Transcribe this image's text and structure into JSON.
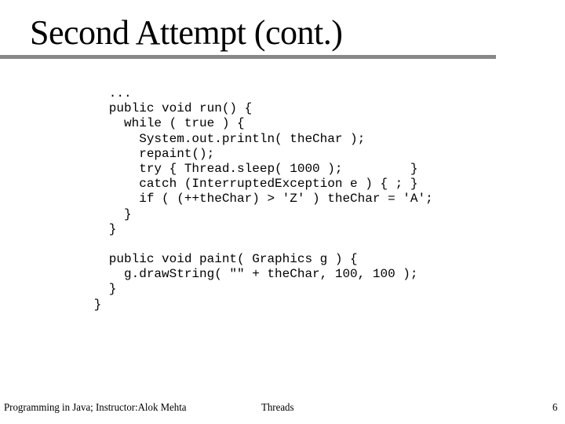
{
  "slide": {
    "title": "Second Attempt (cont.)",
    "code_lines": [
      "   ...",
      "   public void run() {",
      "     while ( true ) {",
      "       System.out.println( theChar );",
      "       repaint();",
      "       try { Thread.sleep( 1000 );         }",
      "       catch (InterruptedException e ) { ; }",
      "       if ( (++theChar) > 'Z' ) theChar = 'A';",
      "     }",
      "   }",
      "",
      "   public void paint( Graphics g ) {",
      "     g.drawString( \"\" + theChar, 100, 100 );",
      "   }",
      " }"
    ]
  },
  "footer": {
    "course": "Programming in Java; Instructor:Alok Mehta",
    "topic": "Threads",
    "page_number": "6"
  }
}
